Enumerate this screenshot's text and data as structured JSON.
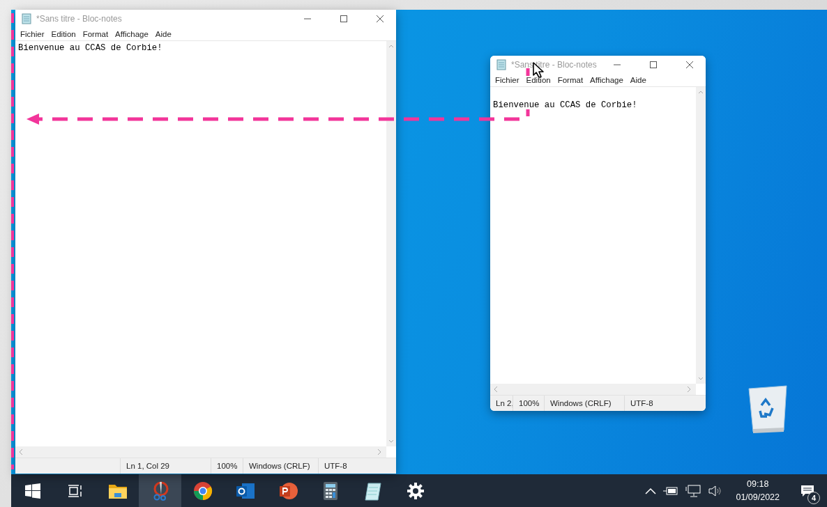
{
  "windows": [
    {
      "title": "*Sans titre - Bloc-notes",
      "menu": [
        "Fichier",
        "Edition",
        "Format",
        "Affichage",
        "Aide"
      ],
      "content": "Bienvenue au CCAS de Corbie!",
      "status": [
        "Ln 1, Col 29",
        "100%",
        "Windows (CRLF)",
        "UTF-8"
      ]
    },
    {
      "title": "*Sans titre - Bloc-notes",
      "menu": [
        "Fichier",
        "Edition",
        "Format",
        "Affichage",
        "Aide"
      ],
      "content": "Bienvenue au CCAS de Corbie!",
      "status": [
        "Ln 2,",
        "100%",
        "Windows (CRLF)",
        "UTF-8"
      ]
    }
  ],
  "taskbar": {
    "apps": [
      {
        "kind": "start",
        "selected": false
      },
      {
        "kind": "taskview",
        "selected": false
      },
      {
        "kind": "explorer",
        "selected": false
      },
      {
        "kind": "snipping",
        "selected": true
      },
      {
        "kind": "chrome",
        "selected": false
      },
      {
        "kind": "outlook",
        "selected": false
      },
      {
        "kind": "powerpoint",
        "selected": false
      },
      {
        "kind": "calculator",
        "selected": false
      },
      {
        "kind": "notepad",
        "selected": false
      },
      {
        "kind": "settings",
        "selected": false
      }
    ],
    "time": "09:18",
    "date": "01/09/2022",
    "notifications": "4"
  }
}
